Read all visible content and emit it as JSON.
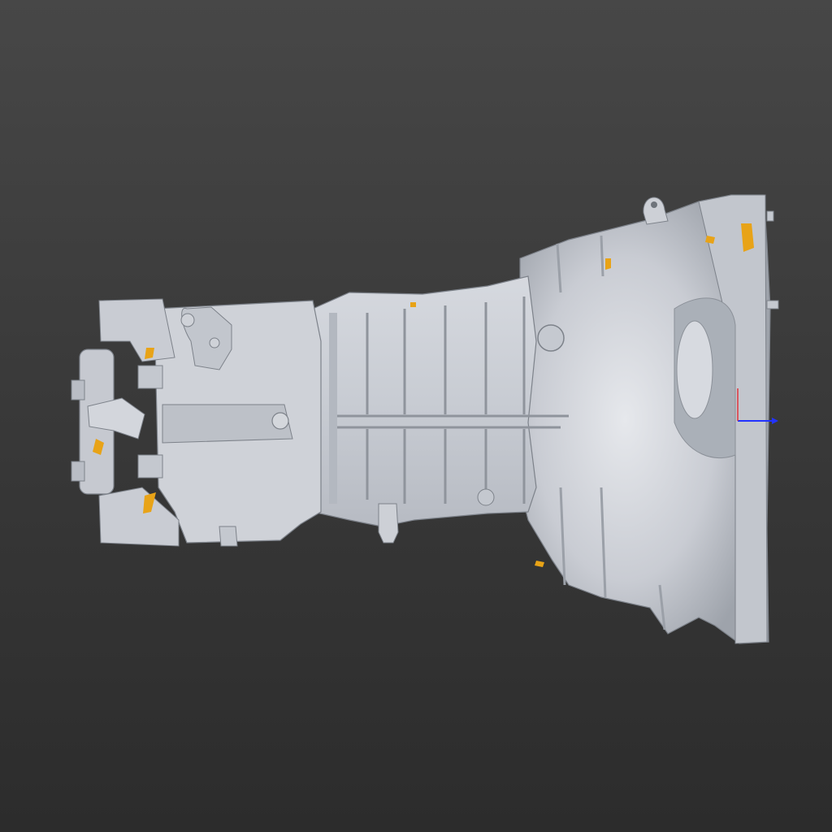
{
  "viewport": {
    "background_top": "#474747",
    "background_bottom": "#2c2c2c"
  },
  "model": {
    "subject": "scanned-gearbox-mesh",
    "surface_color": "#c9ccd3",
    "shadow_color": "#8e939c",
    "highlight_color": "#eef0f4",
    "backface_color": "#e8a317"
  },
  "axis_gizmo": {
    "x_color": "#2233ff",
    "y_color": "#e0303a",
    "icon": "axis-triad-icon"
  }
}
